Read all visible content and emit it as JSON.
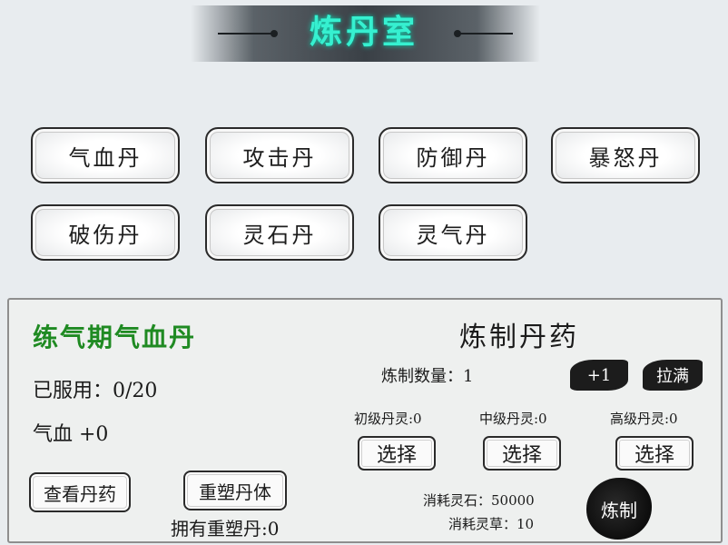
{
  "title": "炼丹室",
  "pills": [
    {
      "label": "气血丹"
    },
    {
      "label": "攻击丹"
    },
    {
      "label": "防御丹"
    },
    {
      "label": "暴怒丹"
    },
    {
      "label": "破伤丹"
    },
    {
      "label": "灵石丹"
    },
    {
      "label": "灵气丹"
    }
  ],
  "detail": {
    "name": "练气期气血丹",
    "taken": "已服用：0/20",
    "effect": "气血 +0",
    "view_button": "查看丹药",
    "reshape_button": "重塑丹体",
    "reshape_owned": "拥有重塑丹:0"
  },
  "refine": {
    "title": "炼制丹药",
    "quantity": "炼制数量：1",
    "plus_one": "+1",
    "max": "拉满",
    "tiers": [
      {
        "label": "初级丹灵:0",
        "button": "选择"
      },
      {
        "label": "中级丹灵:0",
        "button": "选择"
      },
      {
        "label": "高级丹灵:0",
        "button": "选择"
      }
    ],
    "cost_stone": "消耗灵石：50000",
    "cost_herb": "消耗灵草：10",
    "refine_button": "炼制"
  },
  "colors": {
    "title": "#36f0d0",
    "pill_name": "#1f8a22"
  }
}
